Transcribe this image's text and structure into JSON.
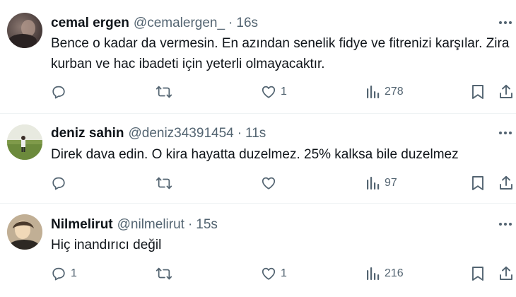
{
  "tweets": [
    {
      "name": "cemal ergen",
      "handle": "@cemalergen_",
      "separator": "·",
      "time": "16s",
      "text_line1": "Bence o kadar da vermesin. En azından senelik fidye ve fitrenizi karşılar. Zira",
      "text_line2": "kurban ve hac ibadeti için yeterli olmayacaktır.",
      "replies": "",
      "retweets": "",
      "likes": "1",
      "views": "278"
    },
    {
      "name": "deniz sahin",
      "handle": "@deniz34391454",
      "separator": "·",
      "time": "11s",
      "text_line1": "Direk dava edin. O kira hayatta duzelmez. 25% kalksa bile duzelmez",
      "replies": "",
      "retweets": "",
      "likes": "",
      "views": "97"
    },
    {
      "name": "Nilmelirut",
      "handle": "@nilmelirut",
      "separator": "·",
      "time": "15s",
      "text_line1": "Hiç inandırıcı değil",
      "replies": "1",
      "retweets": "",
      "likes": "1",
      "views": "216"
    }
  ],
  "icons": {
    "reply": "reply-icon",
    "retweet": "retweet-icon",
    "like": "heart-icon",
    "views": "views-icon",
    "bookmark": "bookmark-icon",
    "share": "share-icon",
    "more": "more-icon"
  },
  "colors": {
    "text": "#0f1419",
    "secondary": "#536471",
    "divider": "#eff3f4"
  }
}
